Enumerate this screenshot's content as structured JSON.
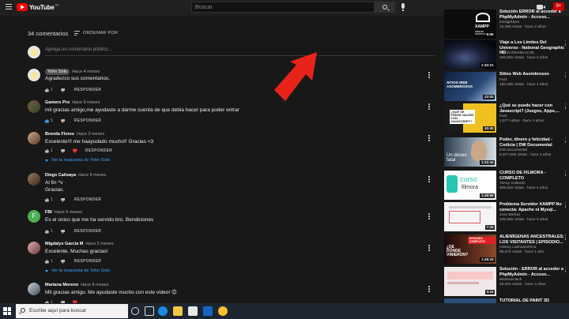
{
  "header": {
    "logo_text": "YouTube",
    "logo_sup": "PE",
    "search_placeholder": "Buscar",
    "notification_count": "9+"
  },
  "comments_section": {
    "count_label": "34 comentarios",
    "sort_label": "ORDENAR POR",
    "add_placeholder": "Agrega un comentario público...",
    "reply_label": "RESPONDER",
    "view_replies_label": "Ver la respuesta de Yohn Soto",
    "comments": [
      {
        "author": "Yohn Soto",
        "time": "Hace 4 meses",
        "text": "Agradezco sus comentarios.",
        "likes": "1"
      },
      {
        "author": "Gamers Pro",
        "time": "Hace 9 meses",
        "text": "mil gracias amigo,me ayudaste a darme cuenta de que debia hacer para poder entrar",
        "likes": "5"
      },
      {
        "author": "Brenda Flores",
        "time": "Hace 3 meses",
        "text": "Excelente!!! me haayudado mucho!! Gracias <3",
        "likes": "1"
      },
      {
        "author": "Diego Calisaya",
        "time": "Hace 9 meses",
        "text": "Al fin ^v",
        "text2": "Gracias.",
        "likes": "1"
      },
      {
        "author": "FBI",
        "time": "Hace 5 meses",
        "text": "Es el único que me ha servido bro. Bendiciones",
        "likes": "1",
        "initial": "F"
      },
      {
        "author": "Migdalys Garcia M",
        "time": "Hace 5 meses",
        "text": "Excelente. Muchas gracias!",
        "likes": "1"
      },
      {
        "author": "Mariana Moreno",
        "time": "Hace 8 meses",
        "text": "Mil gracias amigo. Me ayudaste mucho con este video! 😊",
        "likes": "1"
      }
    ]
  },
  "sidebar": {
    "videos": [
      {
        "title": "Solución ERROR al acceder a PhpMyAdmin - Acceso...",
        "channel": "DesignHpro",
        "stats": "16,258 vistas · hace 2 años",
        "duration": "6:05",
        "thumb_text": "XAMPP",
        "thumb_sub": "ERROR PHPMYADMIN"
      },
      {
        "title": "Viaje a Los Limites Del Universo - National Geographic HD",
        "channel": "KASKARRABIAS 69",
        "stats": "346,681 vistas · hace 2 años",
        "duration": "1:32:21",
        "thumb_text": "",
        "thumb_sub": ""
      },
      {
        "title": "Sitios Web Asombrosos",
        "channel": "Fazt",
        "stats": "100,395 vistas · hace 4 años",
        "duration": "22:02",
        "thumb_text": "SITIOS WEB ASOMBROSOS",
        "thumb_sub": ""
      },
      {
        "title": "¿Qué se puede hacer con Javascript? (Juegos, Apps,...",
        "channel": "Fazt",
        "stats": "1,577 vistas · hace 4 años",
        "duration": "20:30",
        "thumb_text": "¿QUE SE PUEDE HACER CON JAVASCRIPT?",
        "thumb_sub": ""
      },
      {
        "title": "Poder, dinero y felicidad - Codicia | DW Documental",
        "channel": "DW Documental",
        "stats": "8,977,000 vistas · hace 2 años",
        "duration": "1:22:44",
        "thumb_text": "Un deseo fatal",
        "thumb_sub": ""
      },
      {
        "title": "CURSO DE FILMORA - COMPLETO",
        "channel": "Yoney Gallardo",
        "stats": "306,940 vistas · hace 2 años",
        "duration": "1:39:59",
        "thumb_text": "curso",
        "thumb_sub": "filmora"
      },
      {
        "title": "Problema Servidor XAMPP No conecta: Apache ni Mysql...",
        "channel": "Jose Burkaz",
        "stats": "225,585 vistas · hace 3 años",
        "duration": "7:34",
        "thumb_text": "",
        "thumb_sub": ""
      },
      {
        "title": "ALIENÍGENAS ANCESTRALES: LOS VISITANTES | EPISODIO...",
        "channel": "History Latinoamérica",
        "stats": "85,870 vistas · hace 1 año",
        "duration": "1:28:33",
        "thumb_text": "¿DE DÓNDE VINIERON?",
        "thumb_sub": "EPISODIO COMPLETO"
      },
      {
        "title": "Solución - ERROR al acceder a PhpMyAdmin - Acceso...",
        "channel": "MantraxHack",
        "stats": "20,000 vistas · hace 4 años",
        "duration": "3:10",
        "thumb_text": "",
        "thumb_sub": ""
      },
      {
        "title": "TUTORIAL DE PAINT 3D",
        "channel": "",
        "stats": "",
        "duration": "",
        "thumb_text": "",
        "thumb_sub": ""
      }
    ]
  },
  "taskbar": {
    "search_placeholder": "Escribe aquí para buscar"
  },
  "colors": {
    "background": "#181818",
    "topbar": "#202020",
    "accent_blue": "#3ea6ff",
    "arrow_red": "#e8231a",
    "youtube_red": "#ff0000"
  }
}
